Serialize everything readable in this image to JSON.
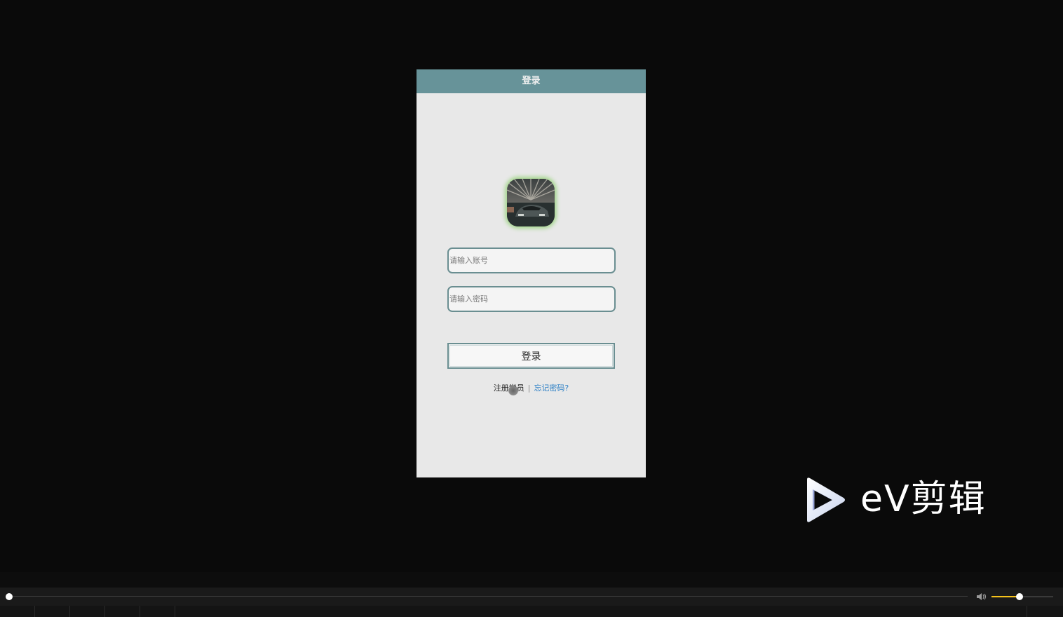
{
  "login": {
    "header_title": "登录",
    "account_placeholder": "请输入账号",
    "password_placeholder": "请输入密码",
    "login_button": "登录",
    "register_link": "注册学员",
    "separator": "|",
    "forgot_link": "忘记密码?"
  },
  "watermark": {
    "text": "eV剪辑"
  },
  "player": {
    "progress_fraction": 0.0,
    "volume_fraction": 0.45
  },
  "colors": {
    "header": "#679399",
    "input_border": "#6a8e91",
    "link": "#2b7fc5",
    "volume_fill": "#f5c21a",
    "logo_glow": "#a6d78f"
  },
  "icons": {
    "logo": "car-photo-icon",
    "play": "play-logo-icon",
    "volume": "speaker-icon"
  }
}
